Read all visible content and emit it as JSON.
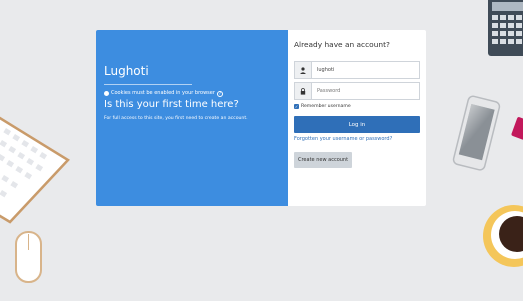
{
  "left_panel": {
    "site_name": "Lughoti",
    "cookies_notice": "Cookies must be enabled in your browser",
    "first_time_heading": "Is this your first time here?",
    "access_note": "For full access to this site, you first need to create an account."
  },
  "login_form": {
    "heading": "Already have an account?",
    "username_value": "lughoti",
    "password_placeholder": "Password",
    "remember_label": "Remember username",
    "login_button": "Log in",
    "forgot_link": "Forgotten your username or password?",
    "create_account_button": "Create new account"
  },
  "colors": {
    "panel_blue": "#3d8de0",
    "primary_button": "#2f6fb8",
    "secondary_button": "#ced4da",
    "background": "#e9eaec"
  },
  "icons": {
    "info": "info-icon",
    "help": "help-icon",
    "username": "user-icon",
    "password": "lock-icon",
    "checkbox": "check-icon"
  }
}
